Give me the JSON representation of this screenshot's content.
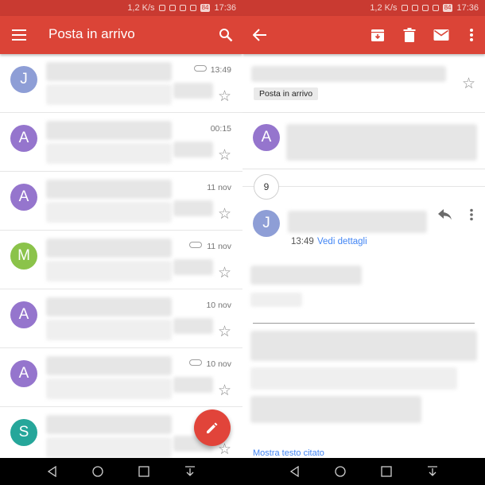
{
  "status_bar": {
    "left_phone": {
      "speed": "1,2 K/s",
      "battery": "84",
      "time": "17:36"
    },
    "right_phone": {
      "speed": "1,2 K/s",
      "battery": "84",
      "time": "17:36"
    }
  },
  "inbox": {
    "title": "Posta in arrivo",
    "rows": [
      {
        "initial": "J",
        "avatar_color": "#8e9ed6",
        "time": "13:49",
        "has_attachment": true
      },
      {
        "initial": "A",
        "avatar_color": "#9575cd",
        "time": "00:15",
        "has_attachment": false
      },
      {
        "initial": "A",
        "avatar_color": "#9575cd",
        "time": "11 nov",
        "has_attachment": false
      },
      {
        "initial": "M",
        "avatar_color": "#8bc34a",
        "time": "11 nov",
        "has_attachment": true
      },
      {
        "initial": "A",
        "avatar_color": "#9575cd",
        "time": "10 nov",
        "has_attachment": false
      },
      {
        "initial": "A",
        "avatar_color": "#9575cd",
        "time": "10 nov",
        "has_attachment": true
      },
      {
        "initial": "S",
        "avatar_color": "#26a69a",
        "time": "",
        "has_attachment": false
      }
    ]
  },
  "thread": {
    "label": "Posta in arrivo",
    "first_sender_initial": "A",
    "first_sender_color": "#9575cd",
    "collapsed_count": "9",
    "message_sender_initial": "J",
    "message_sender_color": "#8e9ed6",
    "message_time": "13:49",
    "details_link": "Vedi dettagli",
    "quoted_link": "Mostra testo citato"
  },
  "colors": {
    "appbar": "#db4437",
    "statusbar": "#c93a31",
    "fab": "#e1443a",
    "link": "#4285f4"
  },
  "icons": [
    "menu-icon",
    "search-icon",
    "back-arrow-icon",
    "archive-icon",
    "delete-icon",
    "mail-icon",
    "more-vert-icon",
    "reply-icon",
    "star-icon",
    "pencil-icon",
    "nav-back-icon",
    "nav-home-icon",
    "nav-recents-icon",
    "nav-notification-icon"
  ]
}
